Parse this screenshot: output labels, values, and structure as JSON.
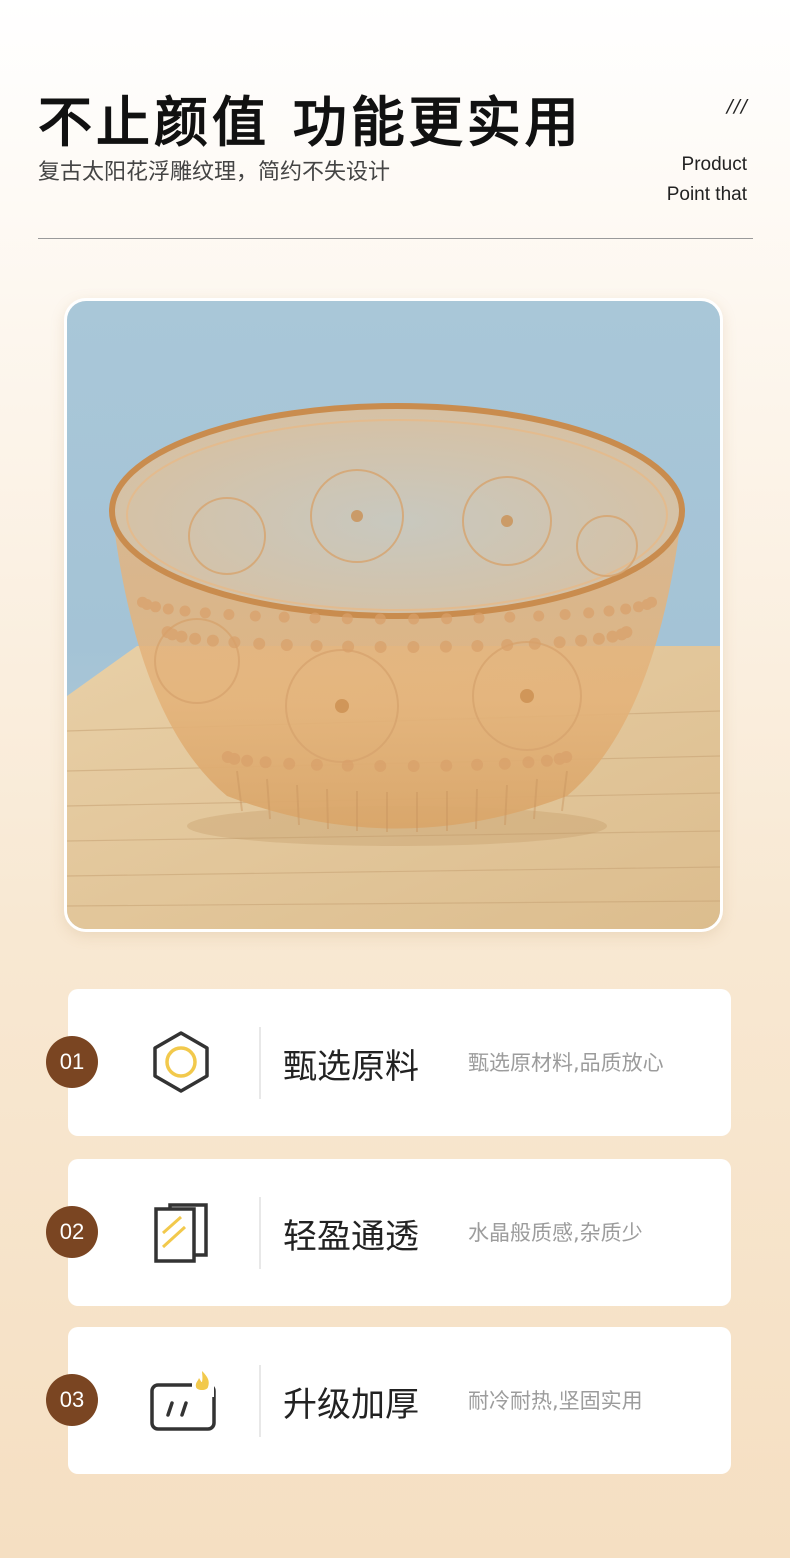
{
  "header": {
    "title": "不止颜值 功能更实用",
    "subtitle": "复古太阳花浮雕纹理，简约不失设计",
    "slashes": "///",
    "point_line1": "Product",
    "point_line2": "Point that"
  },
  "features": [
    {
      "number": "01",
      "title": "甄选原料",
      "desc": "甄选原材料,品质放心",
      "icon": "hexagon-circle-icon"
    },
    {
      "number": "02",
      "title": "轻盈通透",
      "desc": "水晶般质感,杂质少",
      "icon": "glass-layers-icon"
    },
    {
      "number": "03",
      "title": "升级加厚",
      "desc": "耐冷耐热,坚固实用",
      "icon": "heat-resistant-icon"
    }
  ],
  "colors": {
    "badge": "#7a4522",
    "accent_gold": "#f2c94c",
    "icon_stroke": "#333333"
  }
}
